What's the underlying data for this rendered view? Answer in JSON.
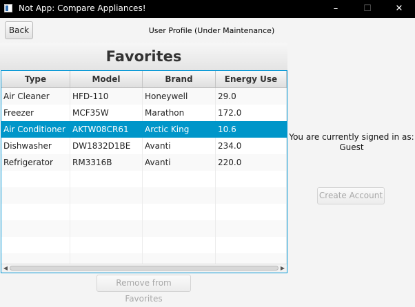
{
  "window": {
    "title": "Not App: Compare Appliances!",
    "min_icon": "minimize-icon",
    "max_icon": "maximize-icon",
    "close_icon": "close-icon"
  },
  "toolbar": {
    "back_label": "Back",
    "page_title": "User Profile (Under Maintenance)"
  },
  "favorites": {
    "title": "Favorites",
    "columns": [
      "Type",
      "Model",
      "Brand",
      "Energy Use"
    ],
    "rows": [
      {
        "type": "Air Cleaner",
        "model": "HFD-110",
        "brand": "Honeywell",
        "energy": "29.0"
      },
      {
        "type": "Freezer",
        "model": "MCF35W",
        "brand": "Marathon",
        "energy": "172.0"
      },
      {
        "type": "Air Conditioner",
        "model": "AKTW08CR61",
        "brand": "Arctic King",
        "energy": "10.6"
      },
      {
        "type": "Dishwasher",
        "model": "DW1832D1BE",
        "brand": "Avanti",
        "energy": "234.0"
      },
      {
        "type": "Refrigerator",
        "model": "RM3316B",
        "brand": "Avanti",
        "energy": "220.0"
      }
    ],
    "selected_row": 2,
    "remove_label": "Remove from Favorites",
    "selection_color": "#0096c9"
  },
  "account": {
    "signed_in_prefix": "You are currently signed in as:",
    "username": "Guest",
    "create_label": "Create Account"
  }
}
